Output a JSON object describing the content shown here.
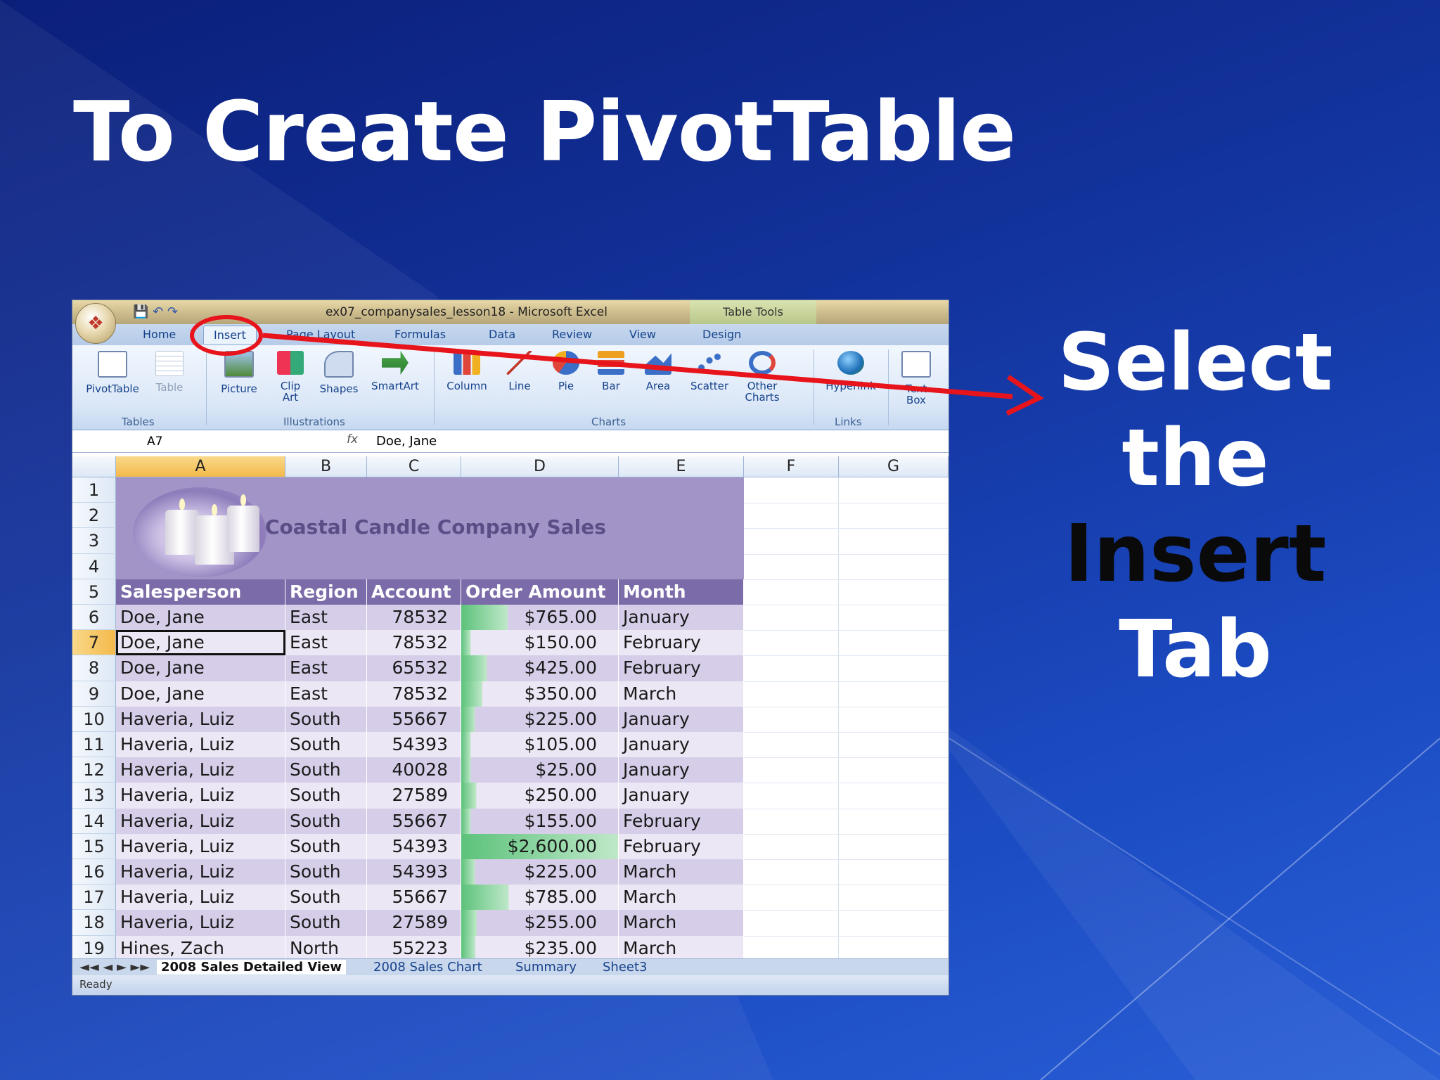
{
  "slide": {
    "title": "To Create PivotTable",
    "callout": {
      "line1": "Select",
      "line2": "the",
      "line3": "Insert",
      "line4": "Tab"
    }
  },
  "excel": {
    "window_title": "ex07_companysales_lesson18 - Microsoft Excel",
    "context_tab_group": "Table Tools",
    "tabs": [
      "Home",
      "Insert",
      "Page Layout",
      "Formulas",
      "Data",
      "Review",
      "View",
      "Design"
    ],
    "active_tab": "Insert",
    "ribbon": {
      "groups": [
        "Tables",
        "Illustrations",
        "Charts",
        "Links"
      ],
      "buttons": [
        {
          "label": "PivotTable",
          "icon": "pivottable-icon"
        },
        {
          "label": "Table",
          "icon": "table-icon"
        },
        {
          "label": "Picture",
          "icon": "picture-icon"
        },
        {
          "label": "Clip Art",
          "icon": "clip-art-icon"
        },
        {
          "label": "Shapes",
          "icon": "shapes-icon"
        },
        {
          "label": "SmartArt",
          "icon": "smartart-icon"
        },
        {
          "label": "Column",
          "icon": "column-chart-icon"
        },
        {
          "label": "Line",
          "icon": "line-chart-icon"
        },
        {
          "label": "Pie",
          "icon": "pie-chart-icon"
        },
        {
          "label": "Bar",
          "icon": "bar-chart-icon"
        },
        {
          "label": "Area",
          "icon": "area-chart-icon"
        },
        {
          "label": "Scatter",
          "icon": "scatter-chart-icon"
        },
        {
          "label": "Other Charts",
          "icon": "other-charts-icon"
        },
        {
          "label": "Hyperlink",
          "icon": "hyperlink-icon"
        },
        {
          "label": "Text Box",
          "icon": "text-box-icon"
        }
      ]
    },
    "name_box": "A7",
    "formula_value": "Doe, Jane",
    "columns": [
      "A",
      "B",
      "C",
      "D",
      "E",
      "F",
      "G"
    ],
    "rows": [
      "1",
      "2",
      "3",
      "4",
      "5",
      "6",
      "7",
      "8",
      "9",
      "10",
      "11",
      "12",
      "13",
      "14",
      "15",
      "16",
      "17",
      "18",
      "19"
    ],
    "selected_cell": "A7",
    "banner_title": "Coastal Candle Company Sales",
    "table_headers": [
      "Salesperson",
      "Region",
      "Account",
      "Order Amount",
      "Month"
    ],
    "table_rows": [
      [
        "Doe, Jane",
        "East",
        "78532",
        "$765.00",
        "January"
      ],
      [
        "Doe, Jane",
        "East",
        "78532",
        "$150.00",
        "February"
      ],
      [
        "Doe, Jane",
        "East",
        "65532",
        "$425.00",
        "February"
      ],
      [
        "Doe, Jane",
        "East",
        "78532",
        "$350.00",
        "March"
      ],
      [
        "Haveria, Luiz",
        "South",
        "55667",
        "$225.00",
        "January"
      ],
      [
        "Haveria, Luiz",
        "South",
        "54393",
        "$105.00",
        "January"
      ],
      [
        "Haveria, Luiz",
        "South",
        "40028",
        "$25.00",
        "January"
      ],
      [
        "Haveria, Luiz",
        "South",
        "27589",
        "$250.00",
        "January"
      ],
      [
        "Haveria, Luiz",
        "South",
        "55667",
        "$155.00",
        "February"
      ],
      [
        "Haveria, Luiz",
        "South",
        "54393",
        "$2,600.00",
        "February"
      ],
      [
        "Haveria, Luiz",
        "South",
        "54393",
        "$225.00",
        "March"
      ],
      [
        "Haveria, Luiz",
        "South",
        "55667",
        "$785.00",
        "March"
      ],
      [
        "Haveria, Luiz",
        "South",
        "27589",
        "$255.00",
        "March"
      ],
      [
        "Hines, Zach",
        "North",
        "55223",
        "$235.00",
        "March"
      ]
    ],
    "sheet_tabs": [
      "2008 Sales Detailed View",
      "2008 Sales Chart",
      "Summary",
      "Sheet3"
    ],
    "active_sheet": "2008 Sales Detailed View",
    "status": "Ready",
    "colors": {
      "banner": "#a394c8",
      "header": "#7b6ba8",
      "band_dark": "#d6cde8",
      "band_light": "#ece7f4",
      "databar": "#5cc27a"
    }
  },
  "annotation": {
    "color": "#e8141b"
  }
}
